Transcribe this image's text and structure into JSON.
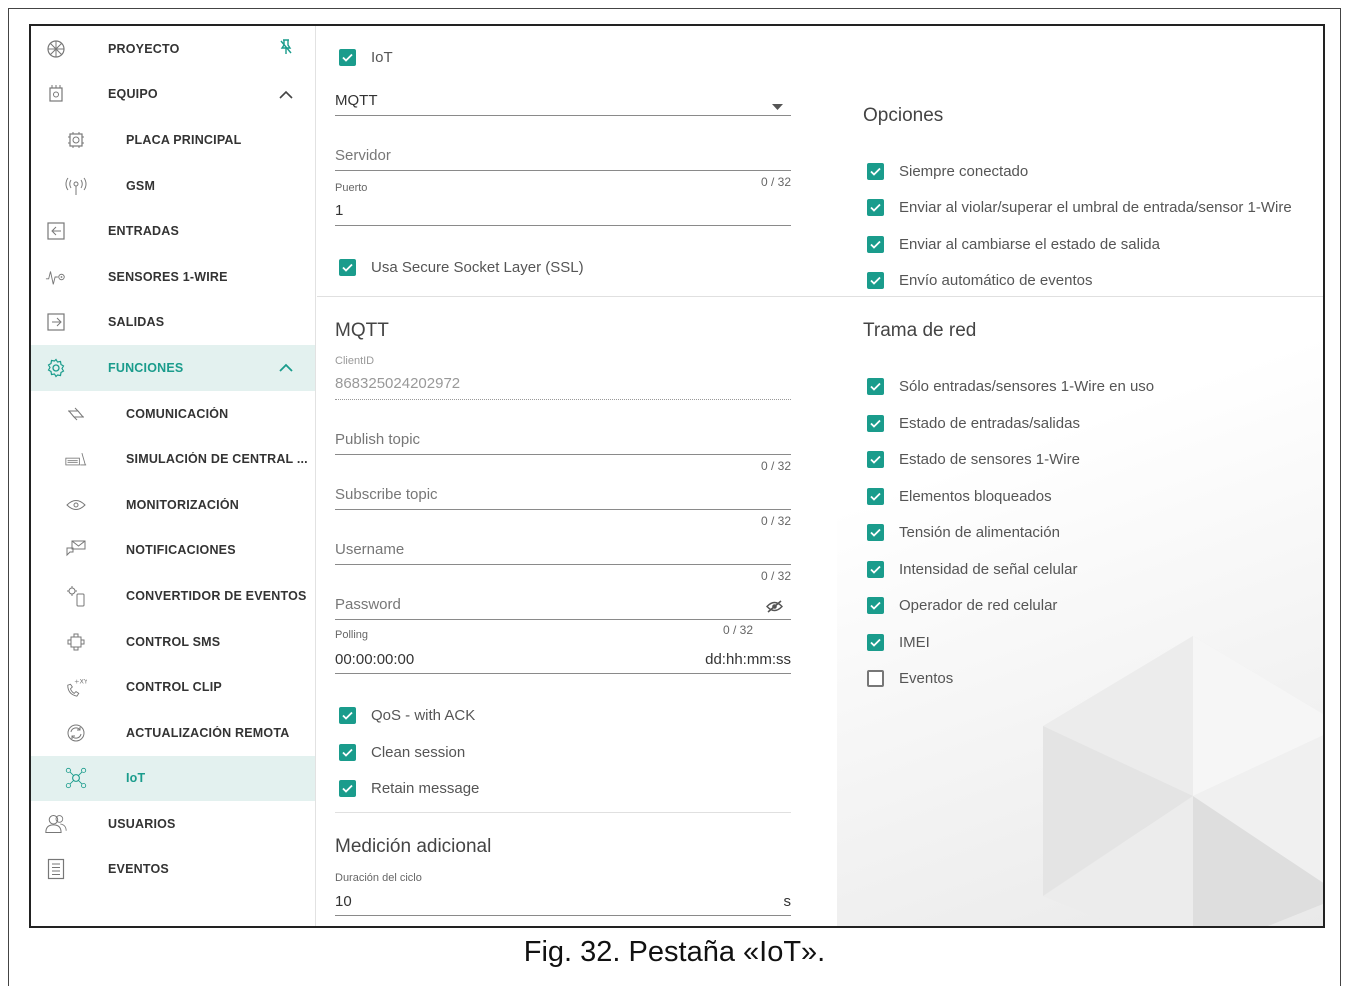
{
  "sidebar": {
    "items": [
      {
        "label": "PROYECTO",
        "icon": "project-icon",
        "trail": "pin-icon"
      },
      {
        "label": "EQUIPO",
        "icon": "equipment-icon",
        "trail": "chevron-up-icon"
      },
      {
        "label": "PLACA PRINCIPAL",
        "icon": "mainboard-icon"
      },
      {
        "label": "GSM",
        "icon": "antenna-icon"
      },
      {
        "label": "ENTRADAS",
        "icon": "input-icon"
      },
      {
        "label": "SENSORES 1-WIRE",
        "icon": "sensor-icon"
      },
      {
        "label": "SALIDAS",
        "icon": "output-icon"
      },
      {
        "label": "FUNCIONES",
        "icon": "gear-icon",
        "trail": "chevron-up-icon"
      },
      {
        "label": "COMUNICACIÓN",
        "icon": "communication-icon"
      },
      {
        "label": "SIMULACIÓN DE CENTRAL ...",
        "icon": "panel-simulation-icon"
      },
      {
        "label": "MONITORIZACIÓN",
        "icon": "eye-icon"
      },
      {
        "label": "NOTIFICACIONES",
        "icon": "notification-icon"
      },
      {
        "label": "CONVERTIDOR DE EVENTOS",
        "icon": "event-converter-icon"
      },
      {
        "label": "CONTROL SMS",
        "icon": "sms-control-icon"
      },
      {
        "label": "CONTROL CLIP",
        "icon": "clip-control-icon"
      },
      {
        "label": "ACTUALIZACIÓN REMOTA",
        "icon": "remote-update-icon"
      },
      {
        "label": "IoT",
        "icon": "iot-icon"
      },
      {
        "label": "USUARIOS",
        "icon": "users-icon"
      },
      {
        "label": "EVENTOS",
        "icon": "events-icon"
      }
    ]
  },
  "form": {
    "iot_checkbox": {
      "label": "IoT",
      "checked": true
    },
    "protocol": {
      "value": "MQTT"
    },
    "server": {
      "placeholder": "Servidor",
      "counter": "0 / 32"
    },
    "port": {
      "label": "Puerto",
      "value": "1"
    },
    "ssl": {
      "label": "Usa Secure Socket Layer (SSL)",
      "checked": true
    },
    "mqtt_title": "MQTT",
    "client_id": {
      "label": "ClientID",
      "value": "868325024202972"
    },
    "publish_topic": {
      "placeholder": "Publish topic",
      "counter": "0 / 32"
    },
    "subscribe_topic": {
      "placeholder": "Subscribe topic",
      "counter": "0 / 32"
    },
    "username": {
      "placeholder": "Username",
      "counter": "0 / 32"
    },
    "password": {
      "placeholder": "Password",
      "counter": "0 / 32"
    },
    "polling": {
      "label": "Polling",
      "value": "00:00:00:00",
      "suffix": "dd:hh:mm:ss"
    },
    "qos": {
      "label": "QoS - with ACK",
      "checked": true
    },
    "clean_session": {
      "label": "Clean session",
      "checked": true
    },
    "retain_message": {
      "label": "Retain message",
      "checked": true
    },
    "extra_title": "Medición adicional",
    "cycle": {
      "label": "Duración del ciclo",
      "value": "10",
      "suffix": "s"
    }
  },
  "options": {
    "title": "Opciones",
    "items": [
      {
        "label": "Siempre conectado",
        "checked": true
      },
      {
        "label": "Enviar al violar/superar el umbral de entrada/sensor 1-Wire",
        "checked": true
      },
      {
        "label": "Enviar al cambiarse el estado de salida",
        "checked": true
      },
      {
        "label": "Envío automático de eventos",
        "checked": true
      }
    ]
  },
  "frame": {
    "title": "Trama de red",
    "items": [
      {
        "label": "Sólo entradas/sensores 1-Wire en uso",
        "checked": true
      },
      {
        "label": "Estado de entradas/salidas",
        "checked": true
      },
      {
        "label": "Estado de sensores 1-Wire",
        "checked": true
      },
      {
        "label": "Elementos bloqueados",
        "checked": true
      },
      {
        "label": "Tensión de alimentación",
        "checked": true
      },
      {
        "label": "Intensidad de señal celular",
        "checked": true
      },
      {
        "label": "Operador de red celular",
        "checked": true
      },
      {
        "label": "IMEI",
        "checked": true
      },
      {
        "label": "Eventos",
        "checked": false
      }
    ]
  },
  "caption": "Fig. 32. Pestaña «IoT».",
  "colors": {
    "accent": "#1a9c8c",
    "active_bg": "#e3f1ef"
  }
}
